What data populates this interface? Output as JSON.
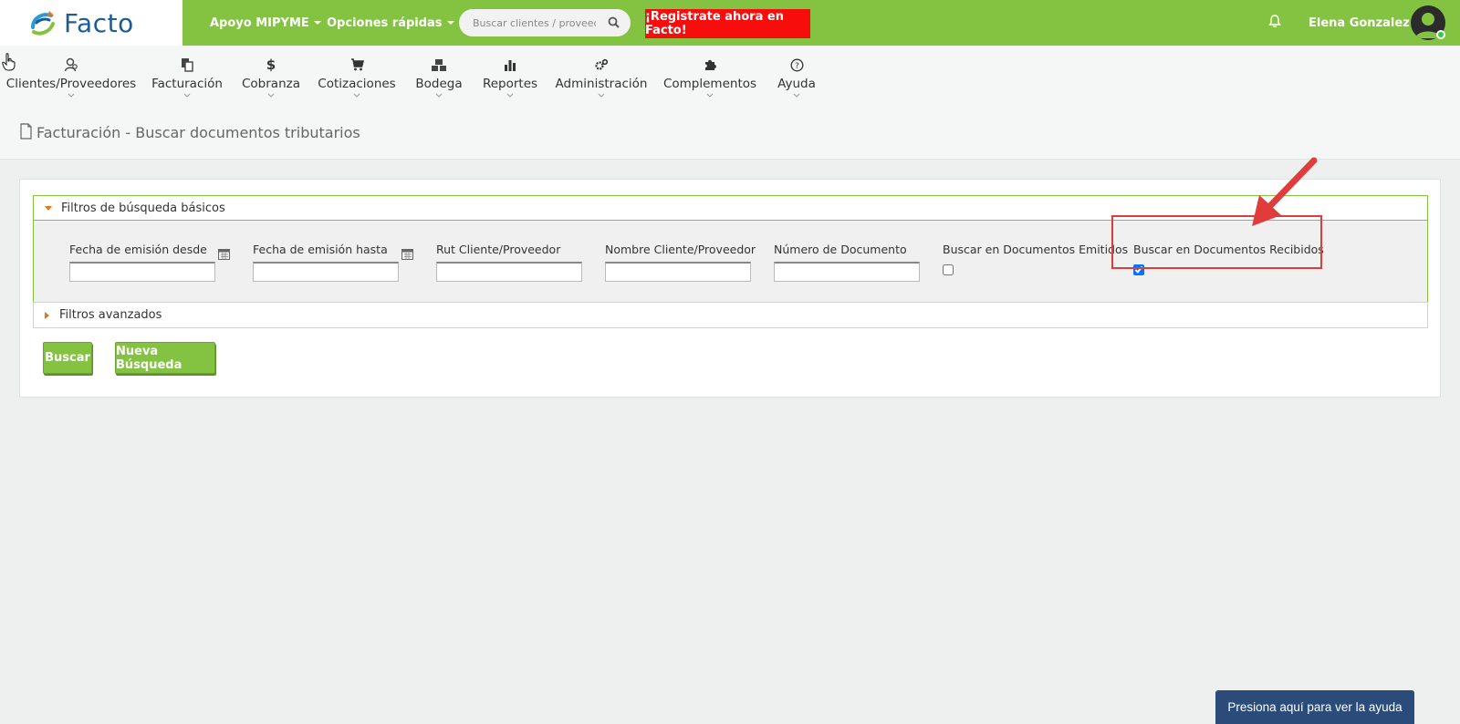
{
  "brand": {
    "name": "Facto"
  },
  "topbar": {
    "apoyo_label": "Apoyo MIPYME",
    "opciones_label": "Opciones rápidas",
    "search_placeholder": "Buscar clientes / proveed",
    "register_label": "¡Registrate ahora en Facto!",
    "user_name": "Elena Gonzalez",
    "colors": {
      "green": "#83c341",
      "red": "#f80d0d"
    }
  },
  "modules": [
    {
      "label": "Clientes/Proveedores",
      "icon": "clients-icon"
    },
    {
      "label": "Facturación",
      "icon": "documents-icon"
    },
    {
      "label": "Cobranza",
      "icon": "dollar-icon"
    },
    {
      "label": "Cotizaciones",
      "icon": "cart-icon"
    },
    {
      "label": "Bodega",
      "icon": "boxes-icon"
    },
    {
      "label": "Reportes",
      "icon": "bar-chart-icon"
    },
    {
      "label": "Administración",
      "icon": "gears-icon"
    },
    {
      "label": "Complementos",
      "icon": "puzzle-icon"
    },
    {
      "label": "Ayuda",
      "icon": "question-icon"
    }
  ],
  "page": {
    "title": "Facturación - Buscar documentos tributarios"
  },
  "filters": {
    "basic_title": "Filtros de búsqueda básicos",
    "advanced_title": "Filtros avanzados",
    "fecha_desde": {
      "label": "Fecha de emisión desde",
      "value": ""
    },
    "fecha_hasta": {
      "label": "Fecha de emisión hasta",
      "value": ""
    },
    "rut": {
      "label": "Rut Cliente/Proveedor",
      "value": ""
    },
    "nombre": {
      "label": "Nombre Cliente/Proveedor",
      "value": ""
    },
    "numero": {
      "label": "Número de Documento",
      "value": ""
    },
    "emitidos": {
      "label": "Buscar en Documentos Emitidos",
      "checked": false
    },
    "recibidos": {
      "label": "Buscar en Documentos Recibidos",
      "checked": true
    }
  },
  "buttons": {
    "buscar": "Buscar",
    "nueva": "Nueva Búsqueda"
  },
  "help": {
    "label": "Presiona aquí para ver la ayuda"
  }
}
